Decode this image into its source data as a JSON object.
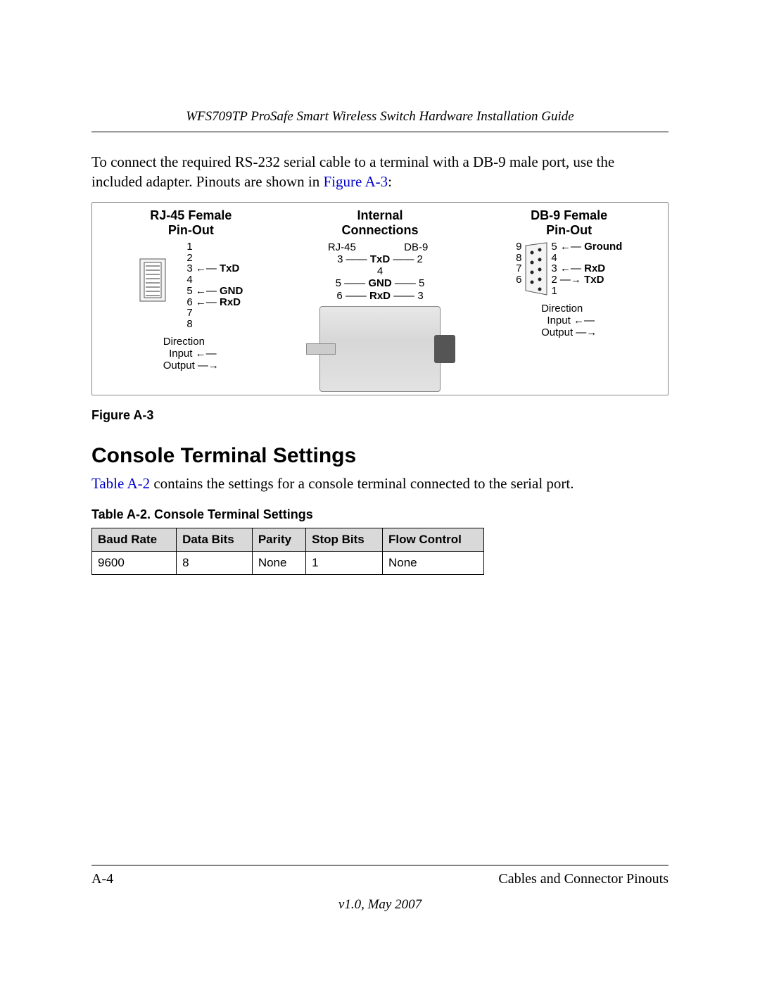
{
  "header": {
    "running_title": "WFS709TP ProSafe Smart Wireless Switch Hardware Installation Guide"
  },
  "intro": {
    "text_before_link": "To connect the required RS-232 serial cable to a terminal with a DB-9 male port, use the included adapter. Pinouts are shown in ",
    "link_text": "Figure A-3",
    "text_after_link": ":"
  },
  "figure": {
    "caption": "Figure A-3",
    "left": {
      "title_line1": "RJ-45 Female",
      "title_line2": "Pin-Out",
      "pins": [
        "1",
        "2",
        "3",
        "4",
        "5",
        "6",
        "7",
        "8"
      ],
      "labels": {
        "3": "TxD",
        "5": "GND",
        "6": "RxD"
      },
      "direction_heading": "Direction",
      "direction_in": "Input",
      "direction_out": "Output"
    },
    "middle": {
      "title_line1": "Internal",
      "title_line2": "Connections",
      "col1_head": "RJ-45",
      "col2_head": "DB-9",
      "rows": [
        {
          "l": "3",
          "name": "TxD",
          "r": "2"
        },
        {
          "l": "4",
          "name": "",
          "r": ""
        },
        {
          "l": "5",
          "name": "GND",
          "r": "5"
        },
        {
          "l": "6",
          "name": "RxD",
          "r": "3"
        }
      ]
    },
    "right": {
      "title_line1": "DB-9 Female",
      "title_line2": "Pin-Out",
      "left_pins": [
        "9",
        "8",
        "7",
        "6"
      ],
      "right_pins": [
        "5",
        "4",
        "3",
        "2",
        "1"
      ],
      "labels": {
        "5": "Ground",
        "3": "RxD",
        "2": "TxD"
      },
      "direction_heading": "Direction",
      "direction_in": "Input",
      "direction_out": "Output"
    }
  },
  "section": {
    "heading": "Console Terminal Settings",
    "text_link": "Table A-2",
    "text_after": " contains the settings for a console terminal connected to the serial port."
  },
  "table": {
    "title": "Table A-2.  Console Terminal Settings",
    "headers": [
      "Baud Rate",
      "Data Bits",
      "Parity",
      "Stop Bits",
      "Flow Control"
    ],
    "row": [
      "9600",
      "8",
      "None",
      "1",
      "None"
    ]
  },
  "footer": {
    "page_num": "A-4",
    "section_name": "Cables and Connector Pinouts",
    "version": "v1.0, May 2007"
  }
}
